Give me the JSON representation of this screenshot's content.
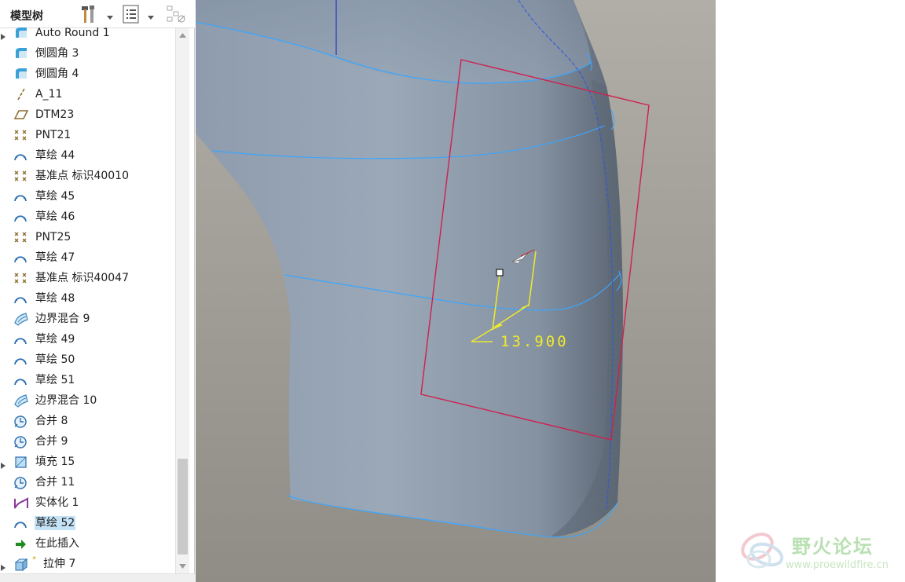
{
  "tree": {
    "title": "模型树",
    "items": [
      {
        "label": "Auto Round 1",
        "icon": "round-icon",
        "expandable": true
      },
      {
        "label": "倒圆角 3",
        "icon": "round-icon",
        "expandable": false
      },
      {
        "label": "倒圆角 4",
        "icon": "round-icon",
        "expandable": false
      },
      {
        "label": "A_11",
        "icon": "axis-icon",
        "expandable": false
      },
      {
        "label": "DTM23",
        "icon": "datum-plane-icon",
        "expandable": false
      },
      {
        "label": "PNT21",
        "icon": "datum-point-icon",
        "expandable": false
      },
      {
        "label": "草绘 44",
        "icon": "sketch-icon",
        "expandable": false
      },
      {
        "label": "基准点 标识40010",
        "icon": "datum-point-icon",
        "expandable": false
      },
      {
        "label": "草绘 45",
        "icon": "sketch-icon",
        "expandable": false
      },
      {
        "label": "草绘 46",
        "icon": "sketch-icon",
        "expandable": false
      },
      {
        "label": "PNT25",
        "icon": "datum-point-icon",
        "expandable": false
      },
      {
        "label": "草绘 47",
        "icon": "sketch-icon",
        "expandable": false
      },
      {
        "label": "基准点 标识40047",
        "icon": "datum-point-icon",
        "expandable": false
      },
      {
        "label": "草绘 48",
        "icon": "sketch-icon",
        "expandable": false
      },
      {
        "label": "边界混合 9",
        "icon": "boundary-blend-icon",
        "expandable": false
      },
      {
        "label": "草绘 49",
        "icon": "sketch-icon",
        "expandable": false
      },
      {
        "label": "草绘 50",
        "icon": "sketch-icon",
        "expandable": false
      },
      {
        "label": "草绘 51",
        "icon": "sketch-icon",
        "expandable": false
      },
      {
        "label": "边界混合 10",
        "icon": "boundary-blend-icon",
        "expandable": false
      },
      {
        "label": "合并 8",
        "icon": "merge-icon",
        "expandable": false
      },
      {
        "label": "合并 9",
        "icon": "merge-icon",
        "expandable": false
      },
      {
        "label": "填充 15",
        "icon": "fill-icon",
        "expandable": true
      },
      {
        "label": "合并 11",
        "icon": "merge-icon",
        "expandable": false
      },
      {
        "label": "实体化 1",
        "icon": "solidify-icon",
        "expandable": false
      },
      {
        "label": "草绘 52",
        "icon": "sketch-icon",
        "expandable": false,
        "selected": true
      },
      {
        "label": "在此插入",
        "icon": "insert-arrow-icon",
        "expandable": false
      },
      {
        "label": "拉伸 7",
        "icon": "extrude-icon",
        "expandable": true
      }
    ]
  },
  "viewport": {
    "dimension_value": "13.900",
    "colors": {
      "background_top": "#a9a79f",
      "background_bottom": "#8e8c84",
      "surface": "#94a2b2",
      "edge": "#3aa6ff",
      "datum_plane": "#d0204e",
      "dimension": "#f0ea2c",
      "axis": "#2233cc"
    }
  },
  "watermark": {
    "title": "野火论坛",
    "url": "www.proewildfire.cn"
  }
}
